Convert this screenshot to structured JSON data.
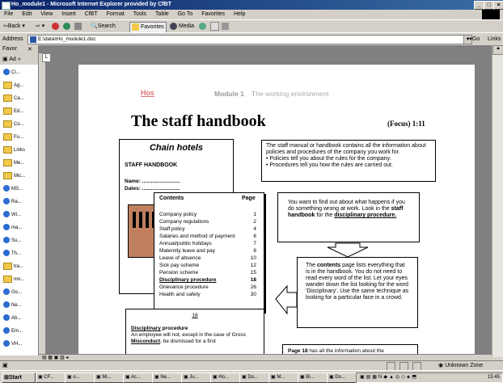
{
  "window": {
    "title": "Ho_module1 - Microsoft Internet Explorer provided by CfBT"
  },
  "menu": [
    "File",
    "Edit",
    "View",
    "Insert",
    "CfBT",
    "Format",
    "Tools",
    "Table",
    "Go To",
    "Favorites",
    "Help"
  ],
  "toolbar": {
    "back": "Back",
    "search": "Search",
    "favorites": "Favorites",
    "media": "Media"
  },
  "address": {
    "label": "Address",
    "value": "E:\\data\\Ho_module1.doc",
    "go": "Go",
    "links": "Links"
  },
  "favorites": {
    "title": "Favor",
    "close": "✕",
    "add": "Ad",
    "items": [
      "Cl...",
      "Ag...",
      "Ca...",
      "Ed...",
      "Co...",
      "Fu...",
      "Links",
      "Me...",
      "Mic...",
      "MS...",
      "Ra...",
      "Wi...",
      "ma...",
      "Su...",
      "Th...",
      "tra...",
      "mo...",
      "Go...",
      "Ne...",
      "Ab...",
      "Em...",
      "VH..."
    ]
  },
  "doc": {
    "hos": "Hos",
    "module": "Module 1",
    "module_sub": "The working environment",
    "title": "The staff handbook",
    "focus": "(Focus) 1:11",
    "cover": {
      "brand": "Chain hotels",
      "heading": "STAFF HANDBOOK",
      "name": "Name: ..........................",
      "dates": "Dates: .........................."
    },
    "contents": {
      "header": "Contents",
      "page": "Page",
      "rows": [
        [
          "Company policy",
          "1"
        ],
        [
          "Company regulations",
          "2"
        ],
        [
          "Staff policy",
          "4"
        ],
        [
          "Salaries and method of payment",
          "6"
        ],
        [
          "Annual/public holidays",
          "7"
        ],
        [
          "Maternity leave and pay",
          "8"
        ],
        [
          "Leave of absence",
          "10"
        ],
        [
          "Sick pay scheme",
          "12"
        ],
        [
          "Pension scheme",
          "15"
        ],
        [
          "Disciplinary procedure",
          "18"
        ],
        [
          "Grievance procedure",
          "26"
        ],
        [
          "Health and safety",
          "30"
        ]
      ]
    },
    "info1": {
      "text": "The staff manual or handbook contains all the information about policies and procedures of the company you work for.",
      "b1": "Policies tell you about the rules for the company.",
      "b2": "Procedures tell you how the rules are carried out."
    },
    "info2": {
      "a": "You want to find out about what happens if you do something wrong at work. Look in the ",
      "b": "staff handbook",
      "c": " for the ",
      "d": "disciplinary procedure."
    },
    "info3": {
      "a": "The ",
      "b": "contents",
      "c": " page lists everything that is in the handbook. You do not need to read every word of the list. Let your eyes wander down the list looking for the word 'Disciplinary'. Use the same technique as looking for a particular face in a crowd."
    },
    "page18": {
      "num": "18",
      "heading": "Disciplinary",
      "heading2": " procedure",
      "text1": "An employee will not, except in the case of Gross ",
      "misconduct": "Misconduct",
      "text2": ", be dismissed for a first"
    },
    "bottom": {
      "a": "Page 18",
      "b": " has all the information about the"
    }
  },
  "status": {
    "zone": "Unknown Zone"
  },
  "taskbar": {
    "start": "Start",
    "tasks": [
      "CF...",
      "o...",
      "Mi...",
      "Ac...",
      "Ne...",
      "Ju...",
      "Ho...",
      "Do...",
      "M...",
      "Bi...",
      "Do..."
    ],
    "clock": "15:45"
  }
}
